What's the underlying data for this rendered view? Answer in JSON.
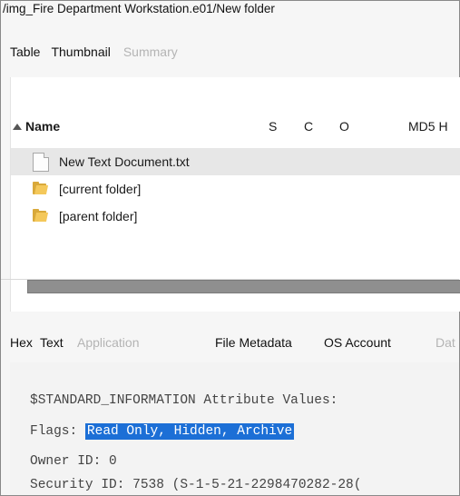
{
  "path": "/img_Fire Department Workstation.e01/New folder",
  "result_tabs": [
    "Table",
    "Thumbnail",
    "Summary"
  ],
  "columns": {
    "name": "Name",
    "s": "S",
    "c": "C",
    "o": "O",
    "md5": "MD5 H"
  },
  "rows": [
    {
      "name": "New Text Document.txt",
      "icon": "text-file-icon"
    },
    {
      "name": "[current folder]",
      "icon": "folder-icon"
    },
    {
      "name": "[parent folder]",
      "icon": "folder-icon"
    }
  ],
  "content_tabs": [
    "Hex",
    "Text",
    "Application",
    "File Metadata",
    "OS Account",
    "Dat"
  ],
  "metadata": {
    "line1": "$STANDARD_INFORMATION Attribute Values:",
    "flags_label": "Flags:",
    "flags_value": "Read Only, Hidden, Archive",
    "owner": "Owner ID: 0",
    "security": "Security ID: 7538 (S-1-5-21-2298470282-28("
  },
  "colors": {
    "selection": "#1c6fd6",
    "selected_row": "#e7e7e7"
  }
}
